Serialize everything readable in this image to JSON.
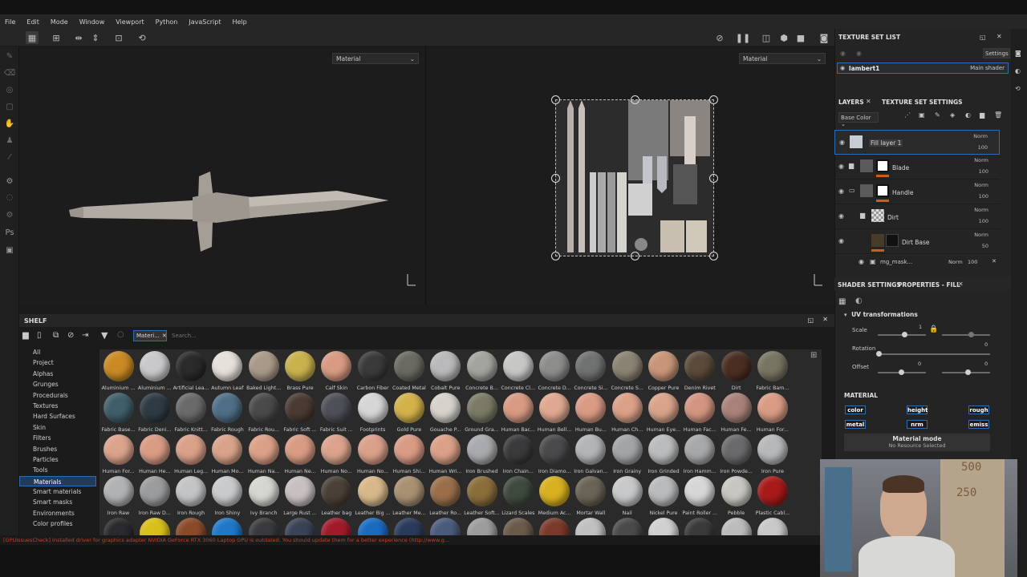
{
  "menu": [
    "File",
    "Edit",
    "Mode",
    "Window",
    "Viewport",
    "Python",
    "JavaScript",
    "Help"
  ],
  "viewport_3d": {
    "mode_label": "Material"
  },
  "viewport_2d": {
    "mode_label": "Material"
  },
  "texture_set_list": {
    "title": "TEXTURE SET LIST",
    "settings_label": "Settings",
    "item_name": "lambert1",
    "item_shader": "Main shader"
  },
  "layers_panel": {
    "tabs": [
      "LAYERS",
      "TEXTURE SET SETTINGS"
    ],
    "channel": "Base Color",
    "layers": [
      {
        "name": "Fill layer 1",
        "blend": "Norm",
        "opacity": "100"
      },
      {
        "name": "Blade",
        "blend": "Norm",
        "opacity": "100"
      },
      {
        "name": "Handle",
        "blend": "Norm",
        "opacity": "100"
      },
      {
        "name": "Dirt",
        "blend": "Norm",
        "opacity": "100"
      },
      {
        "name": "Dirt Base",
        "blend": "Norm",
        "opacity": "50"
      },
      {
        "name": "mg_mask...",
        "blend": "Norm",
        "opacity": "100"
      }
    ]
  },
  "properties": {
    "tabs": [
      "SHADER SETTINGS",
      "PROPERTIES - FILL"
    ],
    "uv_title": "UV transformations",
    "scale_label": "Scale",
    "scale_value": "1",
    "rotation_label": "Rotation",
    "rotation_value": "0",
    "offset_label": "Offset",
    "offset_u": "0",
    "offset_v": "0",
    "material_title": "MATERIAL",
    "channels": [
      "color",
      "height",
      "rough",
      "metal",
      "nrm",
      "emiss"
    ],
    "material_mode": "Material mode",
    "no_resource": "No Resource Selected"
  },
  "shelf": {
    "title": "SHELF",
    "filter_chip": "Materi...",
    "search_placeholder": "Search...",
    "categories": [
      "All",
      "Project",
      "Alphas",
      "Grunges",
      "Procedurals",
      "Textures",
      "Hard Surfaces",
      "Skin",
      "Filters",
      "Brushes",
      "Particles",
      "Tools",
      "Materials",
      "Smart materials",
      "Smart masks",
      "Environments",
      "Color profiles"
    ],
    "selected_category": "Materials",
    "materials": [
      {
        "label": "Aluminium ...",
        "color": "#c98a24"
      },
      {
        "label": "Aluminium ...",
        "color": "#c9c9cb"
      },
      {
        "label": "Artificial Lea...",
        "color": "#2a2a2a"
      },
      {
        "label": "Autumn Leaf",
        "color": "#e6e0da"
      },
      {
        "label": "Baked Light...",
        "color": "#a99a88"
      },
      {
        "label": "Brass Pure",
        "color": "#c9b24e"
      },
      {
        "label": "Calf Skin",
        "color": "#d89a82"
      },
      {
        "label": "Carbon Fiber",
        "color": "#3a3a3a"
      },
      {
        "label": "Coated Metal",
        "color": "#6a6a62"
      },
      {
        "label": "Cobalt Pure",
        "color": "#b9b9bb"
      },
      {
        "label": "Concrete B...",
        "color": "#a3a39f"
      },
      {
        "label": "Concrete Cl...",
        "color": "#c7c7c5"
      },
      {
        "label": "Concrete D...",
        "color": "#8d8d8b"
      },
      {
        "label": "Concrete Si...",
        "color": "#707272"
      },
      {
        "label": "Concrete S...",
        "color": "#8a8272"
      },
      {
        "label": "Copper Pure",
        "color": "#c79578"
      },
      {
        "label": "Denim Rivet",
        "color": "#5b4a3a"
      },
      {
        "label": "Dirt",
        "color": "#4a2e22"
      },
      {
        "label": "Fabric Bam...",
        "color": "#787462"
      },
      {
        "label": "Fabric Base...",
        "color": "#3f5e6a"
      },
      {
        "label": "Fabric Deni...",
        "color": "#2e3a44"
      },
      {
        "label": "Fabric Knitt...",
        "color": "#6a6a6a"
      },
      {
        "label": "Fabric Rough",
        "color": "#4f6f86"
      },
      {
        "label": "Fabric Rou...",
        "color": "#4a4a4a"
      },
      {
        "label": "Fabric Soft ...",
        "color": "#4a3a32"
      },
      {
        "label": "Fabric Suit ...",
        "color": "#4e5058"
      },
      {
        "label": "Footprints",
        "color": "#d6d6d6"
      },
      {
        "label": "Gold Pure",
        "color": "#d3b24a"
      },
      {
        "label": "Gouache P...",
        "color": "#d6d2cc"
      },
      {
        "label": "Ground Gra...",
        "color": "#7a7a66"
      },
      {
        "label": "Human Bac...",
        "color": "#d89a82"
      },
      {
        "label": "Human Bell...",
        "color": "#e0a890"
      },
      {
        "label": "Human Bu...",
        "color": "#d99b84"
      },
      {
        "label": "Human Ch...",
        "color": "#dba088"
      },
      {
        "label": "Human Eye...",
        "color": "#d9a38a"
      },
      {
        "label": "Human Fac...",
        "color": "#d39580"
      },
      {
        "label": "Human Fe...",
        "color": "#a8827a"
      },
      {
        "label": "Human For...",
        "color": "#d99b84"
      },
      {
        "label": "Human For...",
        "color": "#dba38c"
      },
      {
        "label": "Human He...",
        "color": "#d99b84"
      },
      {
        "label": "Human Leg...",
        "color": "#dba088"
      },
      {
        "label": "Human Mo...",
        "color": "#d9a38a"
      },
      {
        "label": "Human Na...",
        "color": "#dba088"
      },
      {
        "label": "Human Ne...",
        "color": "#d99b84"
      },
      {
        "label": "Human No...",
        "color": "#dba38c"
      },
      {
        "label": "Human No...",
        "color": "#d9a08a"
      },
      {
        "label": "Human Shi...",
        "color": "#d99b84"
      },
      {
        "label": "Human Wri...",
        "color": "#dba088"
      },
      {
        "label": "Iron Brushed",
        "color": "#a8aaad"
      },
      {
        "label": "Iron Chain...",
        "color": "#3a3a3c"
      },
      {
        "label": "Iron Diamo...",
        "color": "#4a4a4c"
      },
      {
        "label": "Iron Galvan...",
        "color": "#b2b4b6"
      },
      {
        "label": "Iron Grainy",
        "color": "#a2a4a6"
      },
      {
        "label": "Iron Grinded",
        "color": "#babcbe"
      },
      {
        "label": "Iron Hamm...",
        "color": "#a6a8aa"
      },
      {
        "label": "Iron Powde...",
        "color": "#6a6a6c"
      },
      {
        "label": "Iron Pure",
        "color": "#b6b8ba"
      },
      {
        "label": "Iron Raw",
        "color": "#b0b2b4"
      },
      {
        "label": "Iron Raw D...",
        "color": "#9a9c9e"
      },
      {
        "label": "Iron Rough",
        "color": "#c2c4c6"
      },
      {
        "label": "Iron Shiny",
        "color": "#c8cacc"
      },
      {
        "label": "Ivy Branch",
        "color": "#d6d6d0"
      },
      {
        "label": "Large Rust ...",
        "color": "#c8c0c0"
      },
      {
        "label": "Leather bag",
        "color": "#4a4036"
      },
      {
        "label": "Leather Big ...",
        "color": "#d8b88a"
      },
      {
        "label": "Leather Me...",
        "color": "#a89072"
      },
      {
        "label": "Leather Ro...",
        "color": "#9a6e4a"
      },
      {
        "label": "Leather Soft...",
        "color": "#8a6e3a"
      },
      {
        "label": "Lizard Scales",
        "color": "#3e4a3e"
      },
      {
        "label": "Medium Ac...",
        "color": "#d8b020"
      },
      {
        "label": "Mortar Wall",
        "color": "#6a6456"
      },
      {
        "label": "Nail",
        "color": "#c6c8ca"
      },
      {
        "label": "Nickel Pure",
        "color": "#b8babc"
      },
      {
        "label": "Paint Roller ...",
        "color": "#d6d6d6"
      },
      {
        "label": "Pebble",
        "color": "#c8c6c0"
      },
      {
        "label": "Plastic Cabl...",
        "color": "#a81a1a"
      },
      {
        "label": "",
        "color": "#2a2a2e"
      },
      {
        "label": "",
        "color": "#d8c018"
      },
      {
        "label": "",
        "color": "#8a4a2a"
      },
      {
        "label": "",
        "color": "#1e78c8"
      },
      {
        "label": "",
        "color": "#3a3a3e"
      },
      {
        "label": "",
        "color": "#3a4256"
      },
      {
        "label": "",
        "color": "#a01a2a"
      },
      {
        "label": "",
        "color": "#1a6ac0"
      },
      {
        "label": "",
        "color": "#2a3a5a"
      },
      {
        "label": "",
        "color": "#4a5a7a"
      },
      {
        "label": "",
        "color": "#9a9c9e"
      },
      {
        "label": "",
        "color": "#6a5a4a"
      },
      {
        "label": "",
        "color": "#7a3a2a"
      },
      {
        "label": "",
        "color": "#c0c0c0"
      },
      {
        "label": "",
        "color": "#4a4a4a"
      },
      {
        "label": "",
        "color": "#d0d0d0"
      },
      {
        "label": "",
        "color": "#3a3a3a"
      },
      {
        "label": "",
        "color": "#bcbcbc"
      },
      {
        "label": "",
        "color": "#c8c8c8"
      }
    ]
  },
  "console": "[GPUIssuesCheck] Installed driver for graphics adapter NVIDIA GeForce RTX 3060 Laptop GPU is outdated. You should update them for a better experience (http://www.g...",
  "webcam": {
    "sign_top": "500",
    "sign_bottom": "250"
  }
}
